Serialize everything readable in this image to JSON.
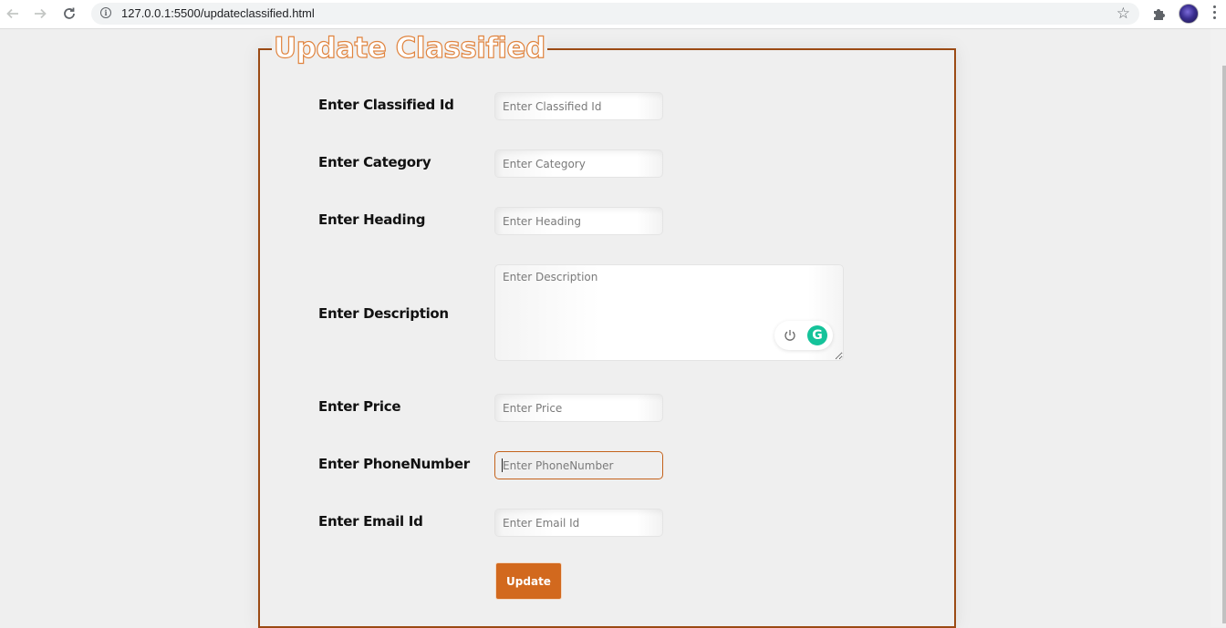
{
  "browser": {
    "url": "127.0.0.1:5500/updateclassified.html",
    "back_icon": "arrow-left-icon",
    "forward_icon": "arrow-right-icon",
    "reload_icon": "reload-icon",
    "info_icon": "info-icon",
    "bookmark_icon": "star-icon",
    "extensions_icon": "puzzle-icon",
    "menu_icon": "kebab-menu-icon"
  },
  "form": {
    "legend": "Update Classified",
    "border_color": "#9b4a14",
    "accent_color": "#d2691e",
    "fields": [
      {
        "label": "Enter Classified Id",
        "placeholder": "Enter Classified Id",
        "value": ""
      },
      {
        "label": "Enter Category",
        "placeholder": "Enter Category",
        "value": ""
      },
      {
        "label": "Enter Heading",
        "placeholder": "Enter Heading",
        "value": ""
      },
      {
        "label": "Enter Description",
        "placeholder": "Enter Description",
        "value": ""
      },
      {
        "label": "Enter Price",
        "placeholder": "Enter Price",
        "value": ""
      },
      {
        "label": "Enter PhoneNumber",
        "placeholder": "Enter PhoneNumber",
        "value": "",
        "focused": true
      },
      {
        "label": "Enter Email Id",
        "placeholder": "Enter Email Id",
        "value": ""
      }
    ],
    "submit_label": "Update"
  },
  "grammarly": {
    "power_icon": "power-icon",
    "logo_icon": "grammarly-icon",
    "logo_letter": "G",
    "logo_color": "#15c39a"
  }
}
